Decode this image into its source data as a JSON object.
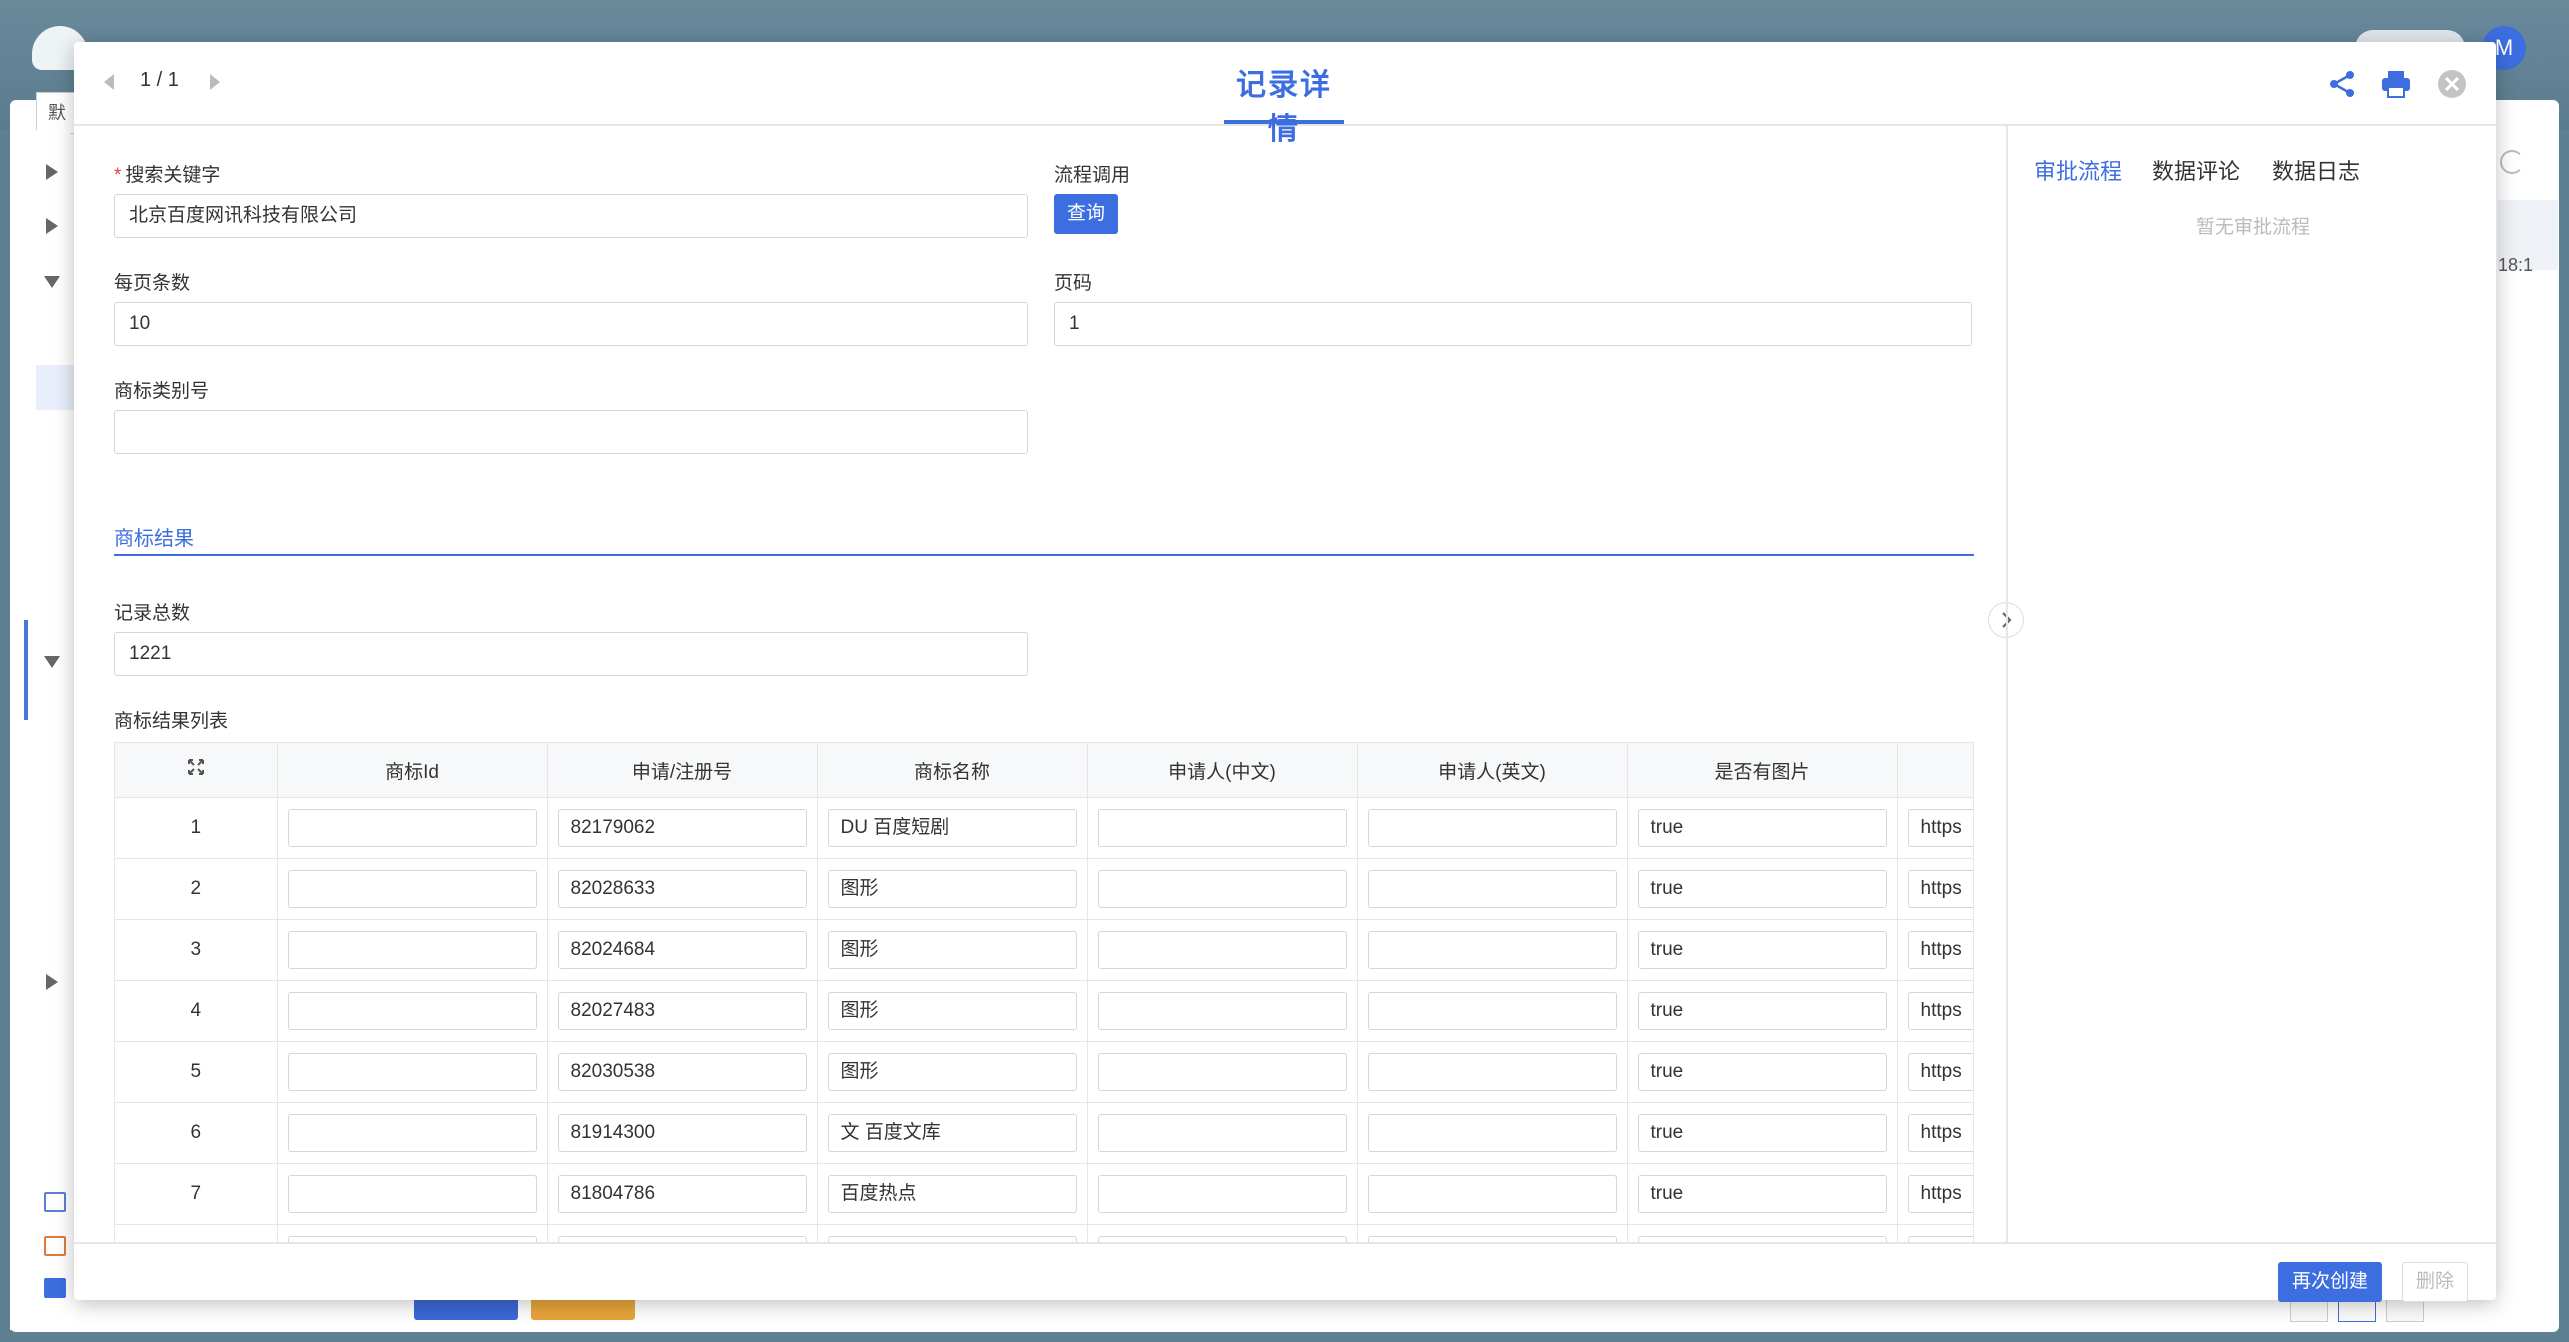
{
  "background": {
    "avatar_initial": "M",
    "tab_char": "默",
    "truncated_time": "18:1"
  },
  "modal": {
    "pager": "1 / 1",
    "title": "记录详情",
    "icons": [
      "share-icon",
      "print-icon",
      "close-icon"
    ]
  },
  "form": {
    "keyword_label": "搜索关键字",
    "keyword_value": "北京百度网讯科技有限公司",
    "flow_label": "流程调用",
    "query_button": "查询",
    "page_size_label": "每页条数",
    "page_size_value": "10",
    "page_label": "页码",
    "page_value": "1",
    "class_label": "商标类别号",
    "class_value": "",
    "section_title": "商标结果",
    "total_label": "记录总数",
    "total_value": "1221",
    "list_label": "商标结果列表"
  },
  "table": {
    "columns": [
      "商标Id",
      "申请/注册号",
      "商标名称",
      "申请人(中文)",
      "申请人(英文)",
      "是否有图片"
    ],
    "rows": [
      {
        "index": "1",
        "reg_no": "82179062",
        "name": "DU 百度短剧",
        "has_image": "true",
        "url": "https"
      },
      {
        "index": "2",
        "reg_no": "82028633",
        "name": "图形",
        "has_image": "true",
        "url": "https"
      },
      {
        "index": "3",
        "reg_no": "82024684",
        "name": "图形",
        "has_image": "true",
        "url": "https"
      },
      {
        "index": "4",
        "reg_no": "82027483",
        "name": "图形",
        "has_image": "true",
        "url": "https"
      },
      {
        "index": "5",
        "reg_no": "82030538",
        "name": "图形",
        "has_image": "true",
        "url": "https"
      },
      {
        "index": "6",
        "reg_no": "81914300",
        "name": "文 百度文库",
        "has_image": "true",
        "url": "https"
      },
      {
        "index": "7",
        "reg_no": "81804786",
        "name": "百度热点",
        "has_image": "true",
        "url": "https"
      }
    ]
  },
  "side_panel": {
    "tabs": [
      "审批流程",
      "数据评论",
      "数据日志"
    ],
    "empty_text": "暂无审批流程"
  },
  "footer": {
    "create_again": "再次创建",
    "delete": "删除"
  },
  "colors": {
    "primary": "#3d6ee0",
    "orange": "#e8a43a"
  }
}
